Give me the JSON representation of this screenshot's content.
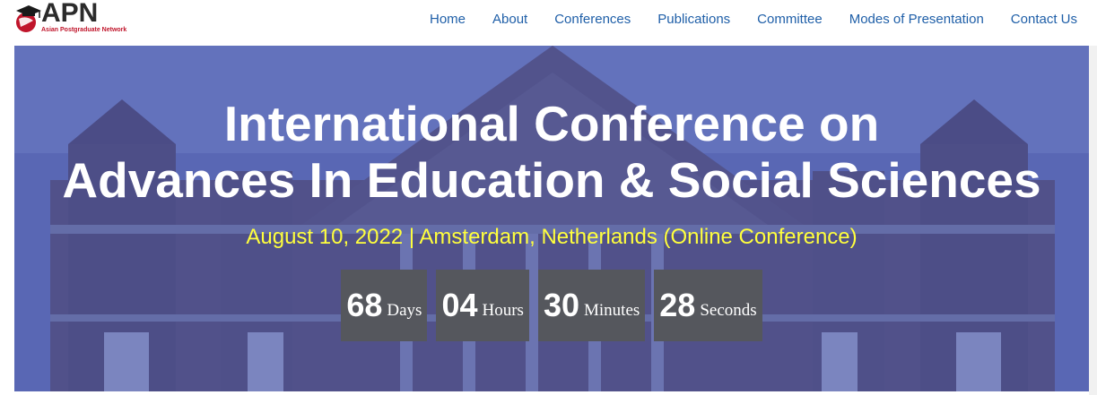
{
  "header": {
    "logo": {
      "word": "APN",
      "tagline": "Asian Postgraduate Network"
    },
    "nav": [
      {
        "label": "Home"
      },
      {
        "label": "About"
      },
      {
        "label": "Conferences"
      },
      {
        "label": "Publications"
      },
      {
        "label": "Committee"
      },
      {
        "label": "Modes of Presentation"
      },
      {
        "label": "Contact Us"
      }
    ]
  },
  "hero": {
    "title_line1": "International Conference on",
    "title_line2": "Advances In Education & Social Sciences",
    "subtitle": "August 10, 2022 | Amsterdam, Netherlands (Online Conference)",
    "countdown": [
      {
        "value": "68",
        "unit": "Days"
      },
      {
        "value": "04",
        "unit": "Hours"
      },
      {
        "value": "30",
        "unit": "Minutes"
      },
      {
        "value": "28",
        "unit": "Seconds"
      }
    ]
  },
  "colors": {
    "nav_link": "#1f5fa8",
    "overlay": "#4c5cb2",
    "subtitle": "#ffff3d",
    "countdown_box": "#55575d",
    "logo_accent": "#c0152b"
  }
}
